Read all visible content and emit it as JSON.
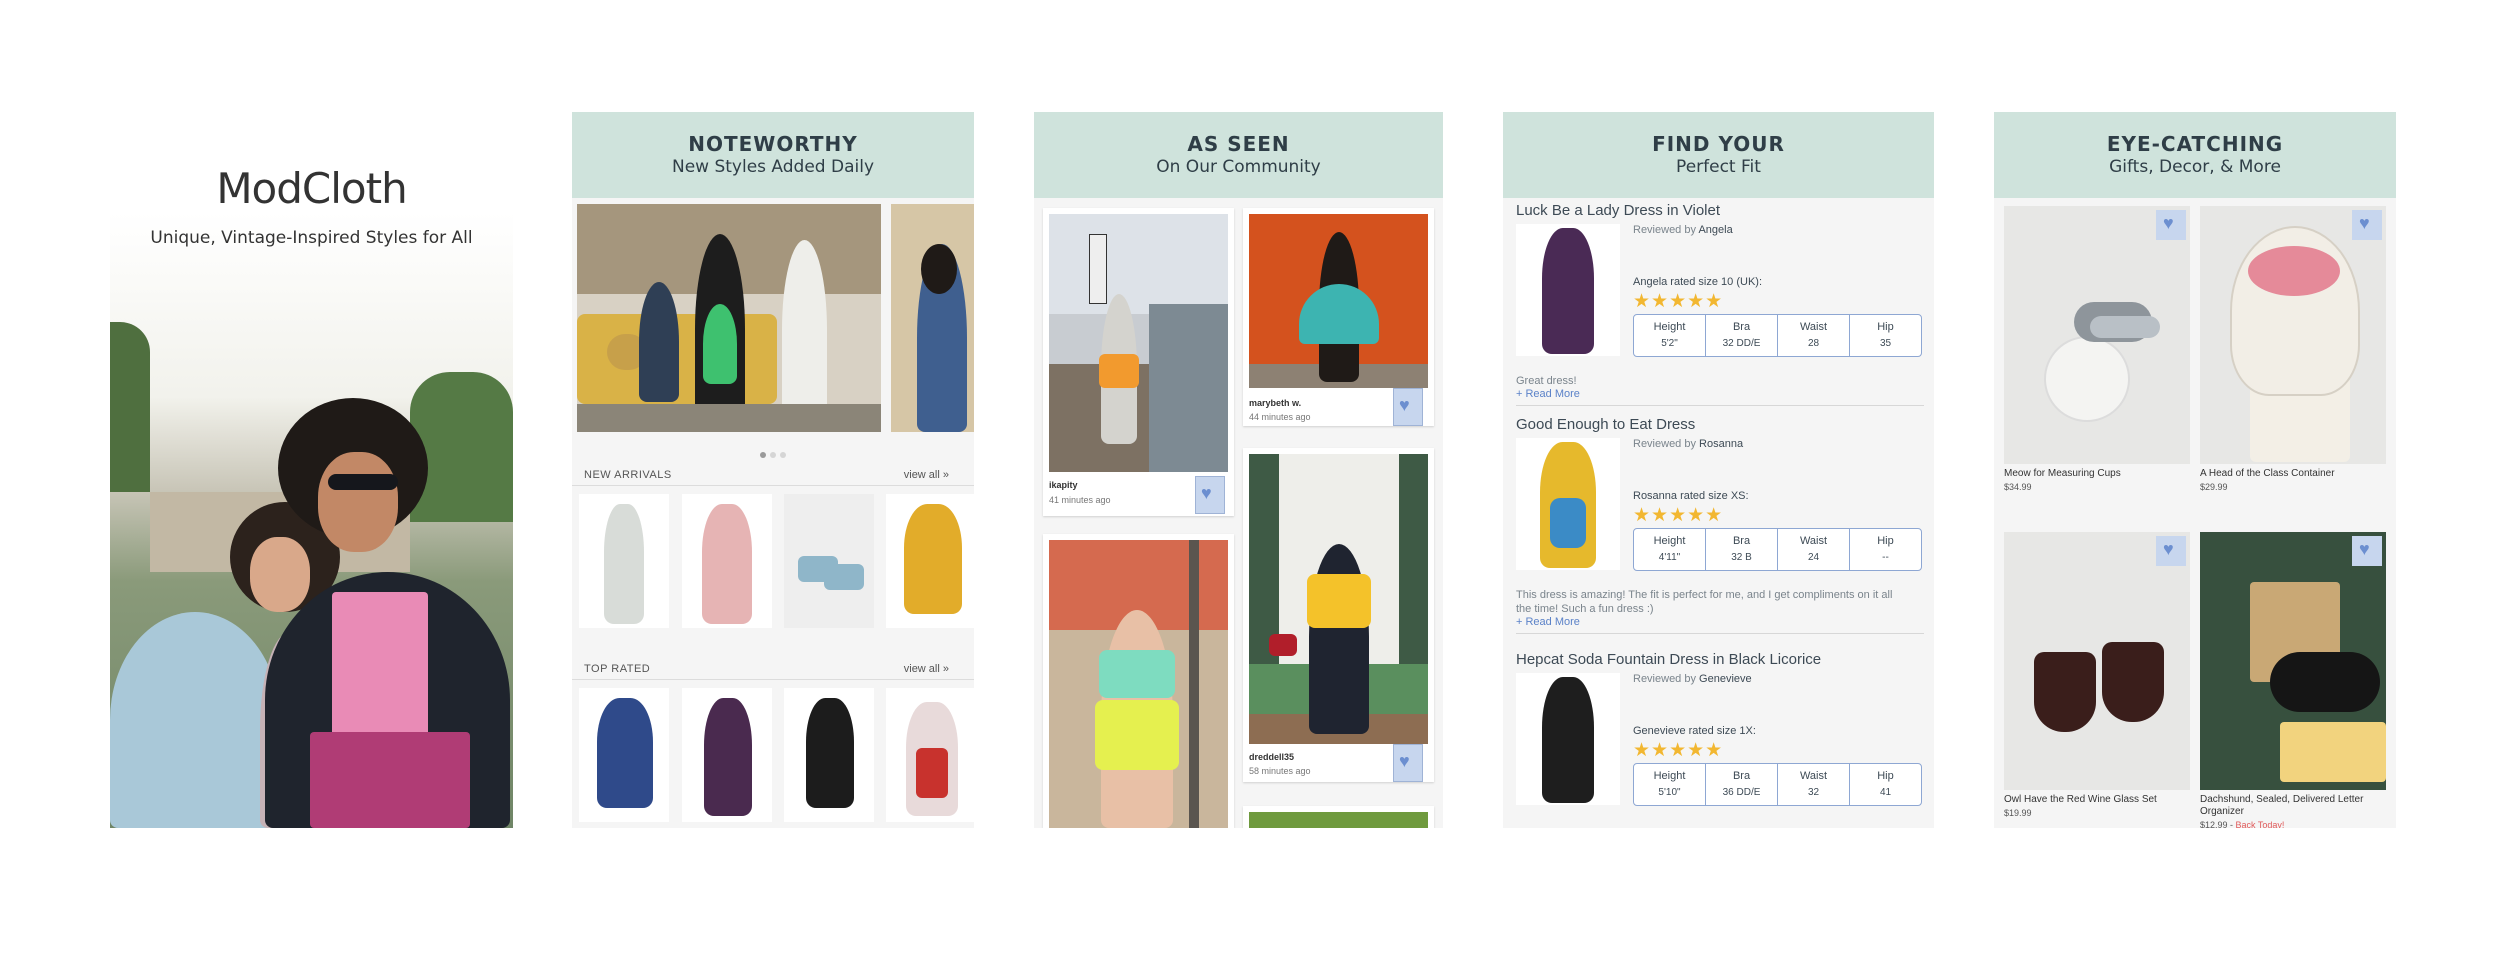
{
  "intro": {
    "logo": "ModCloth",
    "tagline": "Unique, Vintage-Inspired Styles for All"
  },
  "noteworthy": {
    "title": "NOTEWORTHY",
    "subtitle": "New Styles Added Daily",
    "new_arrivals": {
      "label": "NEW ARRIVALS",
      "link": "view all »"
    },
    "top_rated": {
      "label": "TOP RATED",
      "link": "view all »"
    },
    "carousel_dots": 3
  },
  "as_seen": {
    "title": "AS SEEN",
    "subtitle": "On Our Community",
    "posts": [
      {
        "user": "ikapity",
        "time": "41 minutes ago"
      },
      {
        "user": "marybeth w.",
        "time": "44 minutes ago"
      },
      {
        "user": "dreddell35",
        "time": "58 minutes ago"
      }
    ]
  },
  "fit": {
    "title": "FIND YOUR",
    "subtitle": "Perfect Fit",
    "headers": {
      "height": "Height",
      "bra": "Bra",
      "waist": "Waist",
      "hip": "Hip"
    },
    "reviews": [
      {
        "product": "Luck Be a Lady Dress in Violet",
        "reviewed_by": "Reviewed by",
        "reviewer": "Angela",
        "rated": "Angela rated size 10 (UK):",
        "stars": "★★★★★",
        "height": "5'2\"",
        "bra": "32 DD/E",
        "waist": "28",
        "hip": "35",
        "comment": "Great dress!",
        "more": "+ Read More"
      },
      {
        "product": "Good Enough to Eat Dress",
        "reviewed_by": "Reviewed by",
        "reviewer": "Rosanna",
        "rated": "Rosanna rated size XS:",
        "stars": "★★★★★",
        "height": "4'11\"",
        "bra": "32 B",
        "waist": "24",
        "hip": "--",
        "comment": "This dress is amazing! The fit is perfect for me, and I get compliments on it all the time! Such a fun dress :)",
        "more": "+ Read More"
      },
      {
        "product": "Hepcat Soda Fountain Dress in Black Licorice",
        "reviewed_by": "Reviewed by",
        "reviewer": "Genevieve",
        "rated": "Genevieve rated size 1X:",
        "stars": "★★★★★",
        "height": "5'10\"",
        "bra": "36 DD/E",
        "waist": "32",
        "hip": "41"
      }
    ]
  },
  "eye_catching": {
    "title": "EYE-CATCHING",
    "subtitle": "Gifts, Decor, & More",
    "products": [
      {
        "name": "Meow for Measuring Cups",
        "price": "$34.99"
      },
      {
        "name": "A Head of the Class Container",
        "price": "$29.99"
      },
      {
        "name": "Owl Have the Red Wine Glass Set",
        "price": "$19.99"
      },
      {
        "name": "Dachshund, Sealed, Delivered Letter Organizer",
        "price": "$12.99 -",
        "sale": "Back Today!"
      }
    ]
  },
  "colors": {
    "header_bg": "#cfe3dc",
    "star": "#f2b731",
    "link_blue": "#5b82c8",
    "heart_blue": "#6c8fd0",
    "sale_red": "#e05a5a"
  },
  "icons": [
    "heart-icon",
    "star-icon"
  ]
}
